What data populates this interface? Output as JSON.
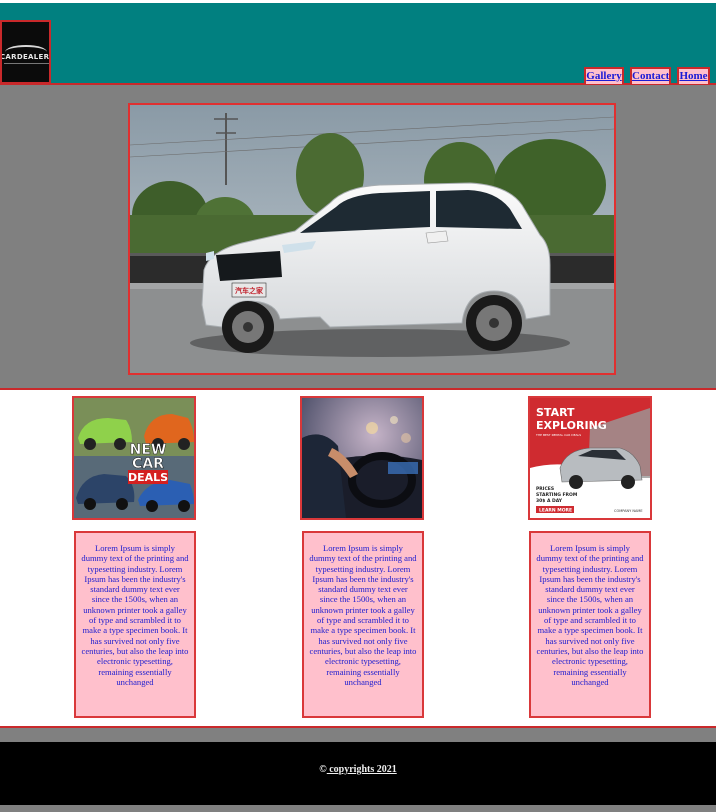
{
  "header": {
    "logo_text": "CARDEALER",
    "nav": {
      "gallery": "Gallery",
      "contact": "Contact",
      "home": "Home"
    }
  },
  "hero": {
    "image": "white-suv-car-photo",
    "badge_text": "汽车之家"
  },
  "cards": [
    {
      "image": "new-car-deals-collage",
      "image_text_line1": "NEW",
      "image_text_line2": "CAR",
      "image_text_line3": "DEALS",
      "text": "Lorem Ipsum is simply dummy text of the printing and typesetting industry. Lorem Ipsum has been the industry's standard dummy text ever since the 1500s, when an unknown printer took a galley of type and scrambled it to make a type specimen book. It has survived not only five centuries, but also the leap into electronic typesetting, remaining essentially unchanged"
    },
    {
      "image": "driver-steering-wheel-night",
      "text": "Lorem Ipsum is simply dummy text of the printing and typesetting industry. Lorem Ipsum has been the industry's standard dummy text ever since the 1500s, when an unknown printer took a galley of type and scrambled it to make a type specimen book. It has survived not only five centuries, but also the leap into electronic typesetting, remaining essentially unchanged"
    },
    {
      "image": "start-exploring-car-rental-ad",
      "image_title_line1": "START",
      "image_title_line2": "EXPLORING",
      "image_subtitle": "THE BEST RENTAL CAR DEALS",
      "image_price_line1": "PRICES",
      "image_price_line2": "STARTING FROM",
      "image_price_line3": "30$ A DAY",
      "image_button": "LEARN MORE",
      "image_brand": "COMPANY NAME",
      "text": "Lorem Ipsum is simply dummy text of the printing and typesetting industry. Lorem Ipsum has been the industry's standard dummy text ever since the 1500s, when an unknown printer took a galley of type and scrambled it to make a type specimen book. It has survived not only five centuries, but also the leap into electronic typesetting, remaining essentially unchanged"
    }
  ],
  "footer": {
    "copyright_symbol": "©",
    "copyright_text": " copyrights 2021"
  },
  "colors": {
    "header_bg": "#018080",
    "hero_bg": "#808080",
    "border_red": "#c9292b",
    "card_pink": "#ffc0cc",
    "link_blue": "#1a1ad6",
    "footer_bg": "#000000"
  }
}
